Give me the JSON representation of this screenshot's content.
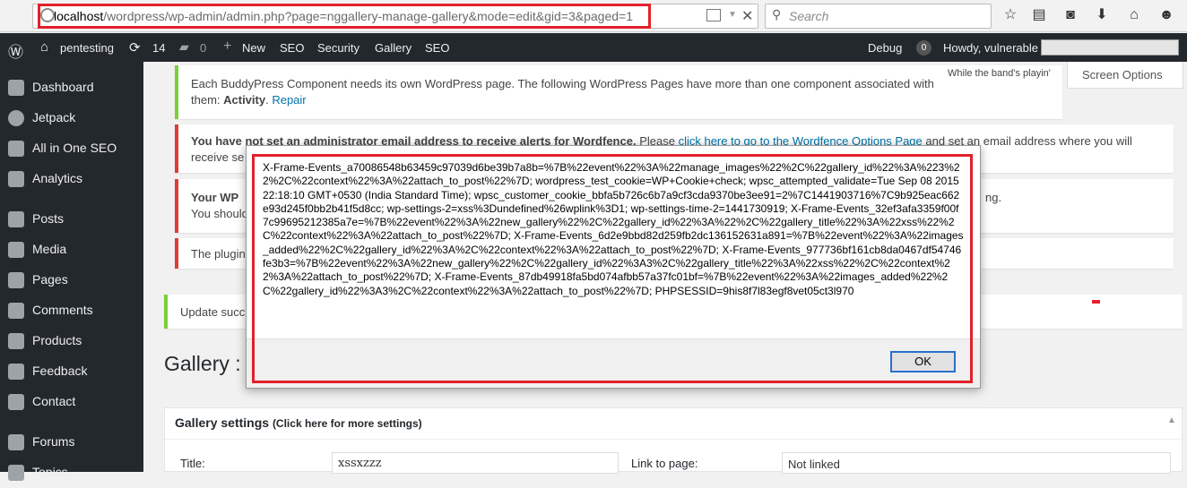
{
  "browser": {
    "url_host": "localhost",
    "url_path": "/wordpress/wp-admin/admin.php?page=nggallery-manage-gallery&mode=edit&gid=3&paged=1",
    "search_placeholder": "Search",
    "icons": [
      "info-icon",
      "reader-view-icon",
      "dropdown-icon",
      "stop-icon",
      "search-icon",
      "bookmark-star-icon",
      "reading-list-icon",
      "pocket-icon",
      "download-icon",
      "home-icon",
      "chat-icon"
    ],
    "highlight_color": "#e3202b"
  },
  "adminbar": {
    "site_name": "pentesting",
    "updates_count": "14",
    "comments_count": "0",
    "new_label": "New",
    "items": [
      "SEO",
      "Security",
      "Gallery",
      "SEO"
    ],
    "debug_label": "Debug",
    "debug_count": "0",
    "howdy": "Howdy, vulnerable"
  },
  "sidebar": {
    "items": [
      {
        "label": "Dashboard",
        "icon": "dashboard-icon"
      },
      {
        "label": "Jetpack",
        "icon": "jetpack-icon"
      },
      {
        "label": "All in One SEO",
        "icon": "seo-icon"
      },
      {
        "label": "Analytics",
        "icon": "analytics-icon"
      },
      {
        "label": "Posts",
        "icon": "pin-icon"
      },
      {
        "label": "Media",
        "icon": "media-icon"
      },
      {
        "label": "Pages",
        "icon": "pages-icon"
      },
      {
        "label": "Comments",
        "icon": "comments-icon"
      },
      {
        "label": "Products",
        "icon": "cart-icon"
      },
      {
        "label": "Feedback",
        "icon": "feedback-icon"
      },
      {
        "label": "Contact",
        "icon": "mail-icon"
      },
      {
        "label": "Forums",
        "icon": "forums-icon"
      },
      {
        "label": "Topics",
        "icon": "topics-icon"
      }
    ]
  },
  "notices": {
    "buddypress_text": "Each BuddyPress Component needs its own WordPress page. The following WordPress Pages have more than one component associated with",
    "buddypress_text2_pre": "them: ",
    "buddypress_bold": "Activity",
    "buddypress_link": "Repair",
    "wordfence_bold": "You have not set an administrator email address to receive alerts for Wordfence.",
    "wordfence_text": "Please",
    "wordfence_link": "click here to go to the Wordfence Options Page",
    "wordfence_text2": "and set an email address where you will",
    "wordfence_line2": "receive se",
    "wp_bold": "Your WP",
    "wp_tail": "ng.",
    "wp_line2": "You should",
    "plugin_text": "The plugin",
    "update_text": "Update succ"
  },
  "screen_options": "Screen Options",
  "band_text": "While the band's playin'",
  "gallery": {
    "title": "Gallery :",
    "settings_head": "Gallery settings",
    "settings_hint": "(Click here for more settings)",
    "title_label": "Title:",
    "title_value": "xssxzzz",
    "link_label": "Link to page:",
    "link_value": "Not linked"
  },
  "modal": {
    "message": "X-Frame-Events_a70086548b63459c97039d6be39b7a8b=%7B%22event%22%3A%22manage_images%22%2C%22gallery_id%22%3A%223%22%2C%22context%22%3A%22attach_to_post%22%7D; wordpress_test_cookie=WP+Cookie+check; wpsc_attempted_validate=Tue Sep 08 2015 22:18:10 GMT+0530 (India Standard Time); wpsc_customer_cookie_bbfa5b726c6b7a9cf3cda9370be3ee91=2%7C1441903716%7C9b925eac662e93d245f0bb2b41f5d8cc; wp-settings-2=xss%3Dundefined%26wplink%3D1; wp-settings-time-2=1441730919; X-Frame-Events_32ef3afa3359f00f7c99695212385a7e=%7B%22event%22%3A%22new_gallery%22%2C%22gallery_id%22%3A%22%2C%22gallery_title%22%3A%22xss%22%2C%22context%22%3A%22attach_to_post%22%7D; X-Frame-Events_6d2e9bbd82d259fb2dc136152631a891=%7B%22event%22%3A%22images_added%22%2C%22gallery_id%22%3A%2C%22context%22%3A%22attach_to_post%22%7D; X-Frame-Events_977736bf161cb8da0467df54746fe3b3=%7B%22event%22%3A%22new_gallery%22%2C%22gallery_id%22%3A3%2C%22gallery_title%22%3A%22xss%22%2C%22context%22%3A%22attach_to_post%22%7D; X-Frame-Events_87db49918fa5bd074afbb57a37fc01bf=%7B%22event%22%3A%22images_added%22%2C%22gallery_id%22%3A3%2C%22context%22%3A%22attach_to_post%22%7D; PHPSESSID=9his8f7l83egf8vet05ct3l970",
    "ok_label": "OK"
  }
}
